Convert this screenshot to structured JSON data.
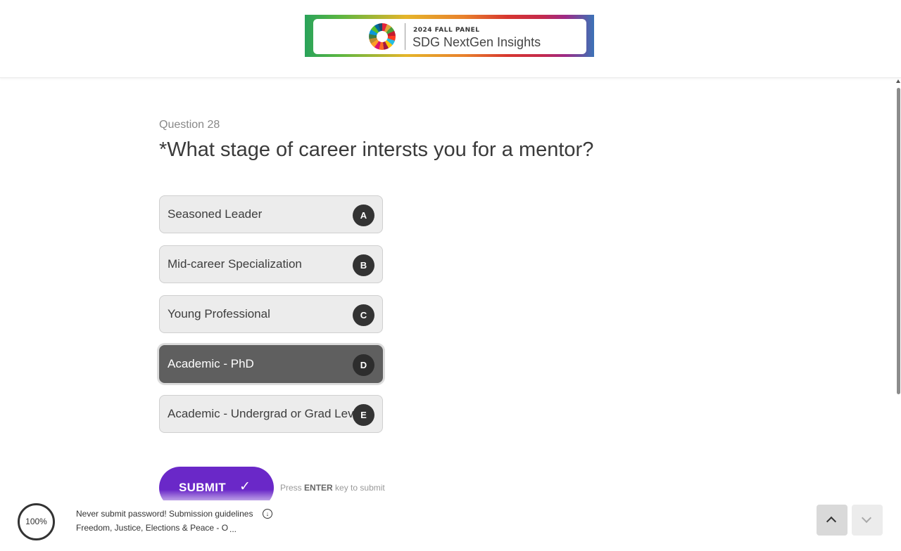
{
  "header": {
    "banner_kicker": "2024 FALL PANEL",
    "banner_title": "SDG NextGen Insights",
    "logo_icon": "sdg-color-wheel-icon"
  },
  "question": {
    "number_label": "Question 28",
    "title": "*What stage of career intersts you for a mentor?",
    "choices": [
      {
        "label": "Seasoned Leader",
        "key": "A",
        "selected": false
      },
      {
        "label": "Mid-career Specialization",
        "key": "B",
        "selected": false
      },
      {
        "label": "Young Professional",
        "key": "C",
        "selected": false
      },
      {
        "label": "Academic - PhD",
        "key": "D",
        "selected": true
      },
      {
        "label": "Academic - Undergrad or Grad Level",
        "key": "E",
        "selected": false
      }
    ]
  },
  "submit": {
    "label": "SUBMIT",
    "icon": "check-icon",
    "hint_prefix": "Press",
    "hint_key": "ENTER",
    "hint_suffix": "key to submit"
  },
  "footer": {
    "progress_label": "100%",
    "progress_value": 1.0,
    "notice": "Never submit password! Submission guidelines",
    "section": "Freedom, Justice, Elections & Peace - O",
    "ellipsis": "..."
  },
  "colors": {
    "accent": "#6a28c8",
    "selected_choice": "#5f5f5f",
    "choice_bg": "#ececec"
  }
}
